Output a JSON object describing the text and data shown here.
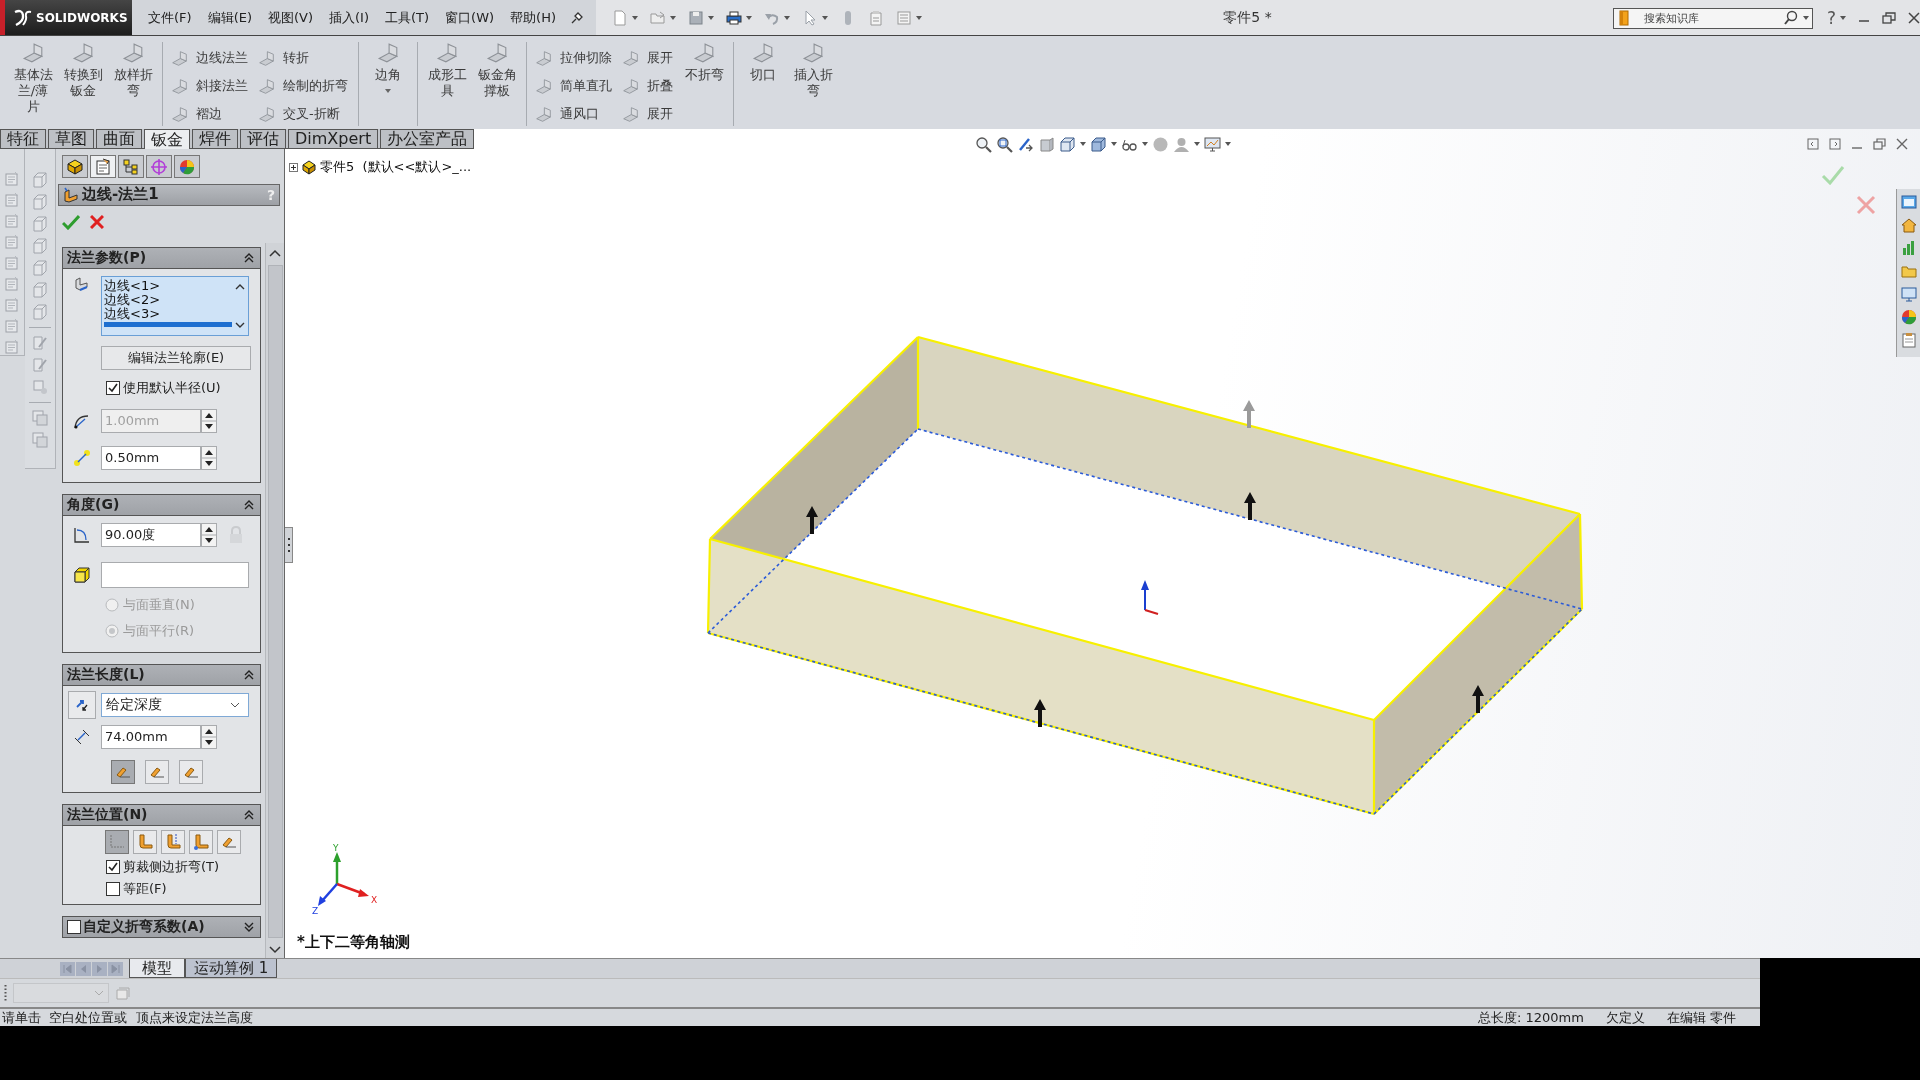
{
  "app": {
    "logo": "SOLIDWORKS"
  },
  "menu": [
    "文件(F)",
    "编辑(E)",
    "视图(V)",
    "插入(I)",
    "工具(T)",
    "窗口(W)",
    "帮助(H)"
  ],
  "window": {
    "title": "零件5 *",
    "help": "?"
  },
  "search": {
    "placeholder": "搜索知识库"
  },
  "command_manager": [
    {
      "items": [
        {
          "kind": "large",
          "label": "基体法兰/薄片",
          "dropdown": false
        },
        {
          "kind": "large",
          "label": "转换到钣金",
          "dropdown": false
        },
        {
          "kind": "large",
          "label": "放样折弯",
          "dropdown": false
        }
      ]
    },
    {
      "items": [
        {
          "kind": "column",
          "labels": [
            "边线法兰",
            "斜接法兰",
            "褶边"
          ]
        },
        {
          "kind": "column",
          "labels": [
            "转折",
            "绘制的折弯",
            "交叉-折断"
          ]
        }
      ]
    },
    {
      "items": [
        {
          "kind": "large",
          "label": "边角",
          "dropdown": true
        }
      ]
    },
    {
      "items": [
        {
          "kind": "large",
          "label": "成形工具",
          "dropdown": false
        },
        {
          "kind": "large",
          "label": "钣金角撑板",
          "dropdown": false
        }
      ]
    },
    {
      "items": [
        {
          "kind": "column",
          "labels": [
            "拉伸切除",
            "简单直孔",
            "通风口"
          ]
        },
        {
          "kind": "column",
          "labels": [
            "展开",
            "折叠",
            "展开"
          ]
        },
        {
          "kind": "large",
          "label": "不折弯",
          "dropdown": false
        }
      ]
    },
    {
      "items": [
        {
          "kind": "large",
          "label": "切口",
          "dropdown": false
        },
        {
          "kind": "large",
          "label": "插入折弯",
          "dropdown": false
        }
      ]
    }
  ],
  "tabs": [
    {
      "label": "特征",
      "selected": false
    },
    {
      "label": "草图",
      "selected": false
    },
    {
      "label": "曲面",
      "selected": false
    },
    {
      "label": "钣金",
      "selected": true
    },
    {
      "label": "焊件",
      "selected": false
    },
    {
      "label": "评估",
      "selected": false
    },
    {
      "label": "DimXpert",
      "selected": false
    },
    {
      "label": "办公室产品",
      "selected": false
    }
  ],
  "panel_tabs": [
    {
      "selected": false
    },
    {
      "selected": true
    },
    {
      "selected": false
    },
    {
      "selected": false
    },
    {
      "selected": false
    }
  ],
  "property_manager": {
    "title": "边线-法兰1",
    "help": "?"
  },
  "flange_params": {
    "title": "法兰参数(P)",
    "expanded": true,
    "edges": [
      {
        "label": "边线<1>",
        "selected": false
      },
      {
        "label": "边线<2>",
        "selected": false
      },
      {
        "label": "边线<3>",
        "selected": false
      }
    ],
    "partial_row_selected": true,
    "edit_button": "编辑法兰轮廓(E)",
    "default_radius": {
      "label": "使用默认半径(U)",
      "checked": true
    },
    "radius": {
      "value": "1.00mm",
      "disabled": true
    },
    "gap": {
      "value": "0.50mm",
      "disabled": false
    }
  },
  "angle": {
    "title": "角度(G)",
    "expanded": true,
    "value": "90.00度",
    "options": [
      {
        "label": "与面垂直(N)",
        "selected": false,
        "disabled": true
      },
      {
        "label": "与面平行(R)",
        "selected": true,
        "disabled": true
      }
    ]
  },
  "flange_length": {
    "title": "法兰长度(L)",
    "expanded": true,
    "end_condition": "给定深度",
    "value": "74.00mm",
    "modes": [
      {
        "selected": true
      },
      {
        "selected": false
      },
      {
        "selected": false
      }
    ]
  },
  "flange_position": {
    "title": "法兰位置(N)",
    "expanded": true,
    "modes": [
      {
        "selected": true
      },
      {
        "selected": false
      },
      {
        "selected": false
      },
      {
        "selected": false
      },
      {
        "selected": false
      }
    ],
    "options": [
      {
        "label": "剪裁侧边折弯(T)",
        "checked": true
      },
      {
        "label": "等距(F)",
        "checked": false
      }
    ]
  },
  "custom_bend": {
    "title": "自定义折弯系数(A)",
    "checked": false,
    "expanded": false
  },
  "viewport": {
    "tree_item": "零件5  (默认<<默认>_...",
    "view_name": "*上下二等角轴测",
    "axes": [
      "X",
      "Y",
      "Z"
    ]
  },
  "model_tabs": [
    {
      "label": "模型",
      "selected": true
    },
    {
      "label": "运动算例 1",
      "selected": false
    }
  ],
  "status_bar": {
    "prompt": "请单击  空白处位置或  顶点来设定法兰高度",
    "info": [
      "总长度: 1200mm",
      "欠定义",
      "在编辑 零件"
    ]
  }
}
